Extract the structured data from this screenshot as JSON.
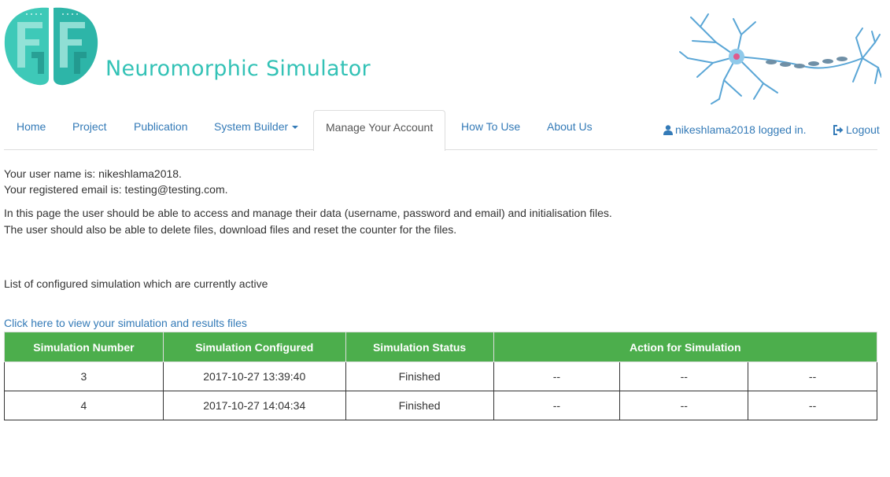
{
  "header": {
    "title": "Neuromorphic Simulator",
    "logo_icon": "brain-logo-icon",
    "image_icon": "neuron-illustration-icon",
    "colors": {
      "brand": "#33c2b6",
      "link": "#337ab7",
      "table_header": "#4cae4c"
    }
  },
  "nav": {
    "items": [
      {
        "label": "Home"
      },
      {
        "label": "Project"
      },
      {
        "label": "Publication"
      },
      {
        "label": "System Builder"
      },
      {
        "label": "Manage Your Account"
      },
      {
        "label": "How To Use"
      },
      {
        "label": "About Us"
      }
    ],
    "active": "Manage Your Account",
    "user_status": "nikeshlama2018 logged in.",
    "logout_label": "Logout"
  },
  "account": {
    "username_line": "Your user name is: nikeshlama2018.",
    "email_line": "Your registered email is: testing@testing.com.",
    "desc_line1": "In this page the user should be able to access and manage their data (username, password and email) and initialisation files.",
    "desc_line2": "The user should also be able to delete files, download files and reset the counter for the files.",
    "list_heading": "List of configured simulation which are currently active",
    "view_link": "Click here to view your simulation and results files"
  },
  "table": {
    "headers": [
      "Simulation Number",
      "Simulation Configured",
      "Simulation Status",
      "Action for Simulation"
    ],
    "rows": [
      {
        "number": "3",
        "configured": "2017-10-27 13:39:40",
        "status": "Finished",
        "actions": [
          "--",
          "--",
          "--"
        ]
      },
      {
        "number": "4",
        "configured": "2017-10-27 14:04:34",
        "status": "Finished",
        "actions": [
          "--",
          "--",
          "--"
        ]
      }
    ]
  }
}
